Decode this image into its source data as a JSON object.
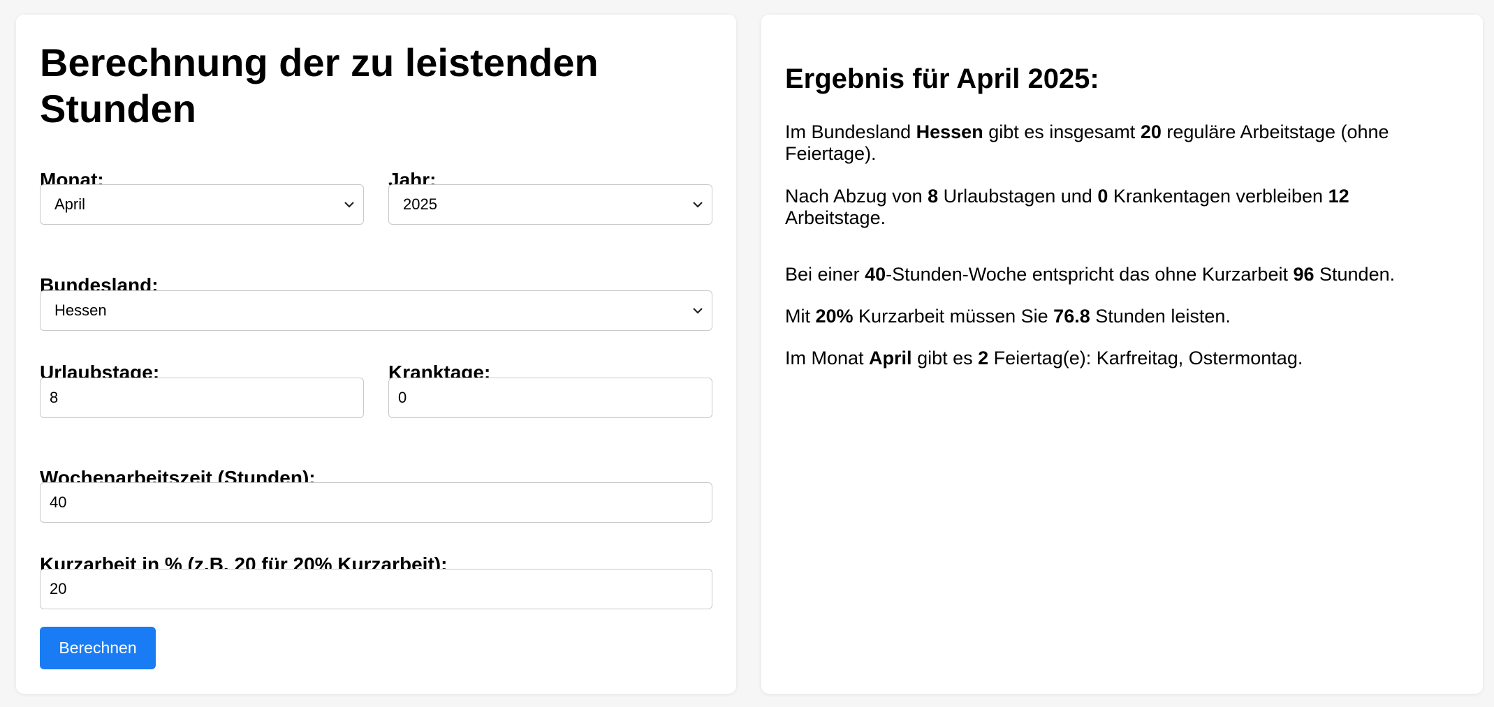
{
  "form": {
    "title": "Berechnung der zu leistenden Stunden",
    "month": {
      "label": "Monat:",
      "value": "April"
    },
    "year": {
      "label": "Jahr:",
      "value": "2025"
    },
    "state": {
      "label": "Bundesland:",
      "value": "Hessen"
    },
    "vacation": {
      "label": "Urlaubstage:",
      "value": "8"
    },
    "sick": {
      "label": "Kranktage:",
      "value": "0"
    },
    "weekly_hours": {
      "label": "Wochenarbeitszeit (Stunden):",
      "value": "40"
    },
    "short_time": {
      "label": "Kurzarbeit in % (z.B. 20 für 20% Kurzarbeit):",
      "value": "20"
    },
    "submit_label": "Berechnen"
  },
  "result": {
    "title": "Ergebnis für April 2025:",
    "p1": {
      "t1": "Im Bundesland ",
      "state": "Hessen",
      "t2": " gibt es insgesamt ",
      "workdays": "20",
      "t3": " reguläre Arbeitstage (ohne Feiertage)."
    },
    "p2": {
      "t1": "Nach Abzug von ",
      "vacation": "8",
      "t2": " Urlaubstagen und ",
      "sick": "0",
      "t3": " Krankentagen verbleiben ",
      "remaining": "12",
      "t4": " Arbeitstage."
    },
    "p3": {
      "t1": "Bei einer ",
      "weekly": "40",
      "t2": "-Stunden-Woche entspricht das ohne Kurzarbeit ",
      "hours": "96",
      "t3": " Stunden."
    },
    "p4": {
      "t1": "Mit ",
      "percent": "20%",
      "t2": " Kurzarbeit müssen Sie ",
      "hours": "76.8",
      "t3": " Stunden leisten."
    },
    "p5": {
      "t1": "Im Monat ",
      "month": "April",
      "t2": " gibt es ",
      "count": "2",
      "t3": " Feiertag(e): Karfreitag, Ostermontag."
    }
  },
  "icons": {
    "dropdown": "chevron-down-icon"
  },
  "colors": {
    "accent": "#1a7cf4",
    "background": "#f6f6f6"
  }
}
